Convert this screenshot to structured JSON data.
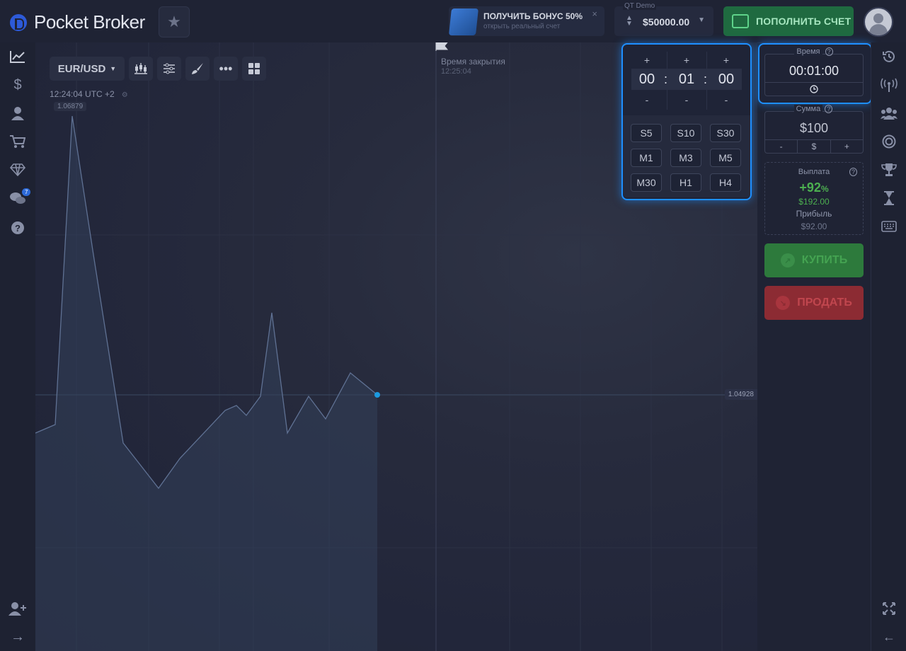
{
  "brand": {
    "name": "Pocket Broker"
  },
  "bonus": {
    "title": "ПОЛУЧИТЬ БОНУС 50%",
    "subtitle": "открыть реальный счет",
    "close": "×"
  },
  "account": {
    "label": "QT Demo",
    "balance": "$50000.00"
  },
  "deposit": {
    "label": "ПОПОЛНИТЬ СЧЕТ"
  },
  "sidebar_left": {
    "chat_badge": "7"
  },
  "chart": {
    "pair": "EUR/USD",
    "clock": "12:24:04 UTC +2",
    "high_label": "1.06879",
    "current_price": "1.04928",
    "expiry_label": "Время закрытия",
    "expiry_time": "12:25:04"
  },
  "time_popup": {
    "plus": "+",
    "minus": "-",
    "hours": "00",
    "minutes": "01",
    "seconds": "00",
    "separator": ":",
    "presets": [
      "S5",
      "S10",
      "S30",
      "M1",
      "M3",
      "M5",
      "M30",
      "H1",
      "H4"
    ]
  },
  "trade": {
    "time_label": "Время",
    "time_value": "00:01:00",
    "sum_label": "Сумма",
    "sum_value": "$100",
    "sum_minus": "-",
    "sum_currency": "$",
    "sum_plus": "+",
    "payout_label": "Выплата",
    "payout_percent": "+92",
    "payout_percent_sign": "%",
    "payout_amount": "$192.00",
    "profit_label": "Прибыль",
    "profit_amount": "$92.00",
    "buy_label": "КУПИТЬ",
    "sell_label": "ПРОДАТЬ"
  },
  "colors": {
    "accent_blue": "#1e8fff",
    "buy_green": "#2d7a3c",
    "sell_red": "#8c2b33",
    "payout_green": "#4caf50"
  }
}
